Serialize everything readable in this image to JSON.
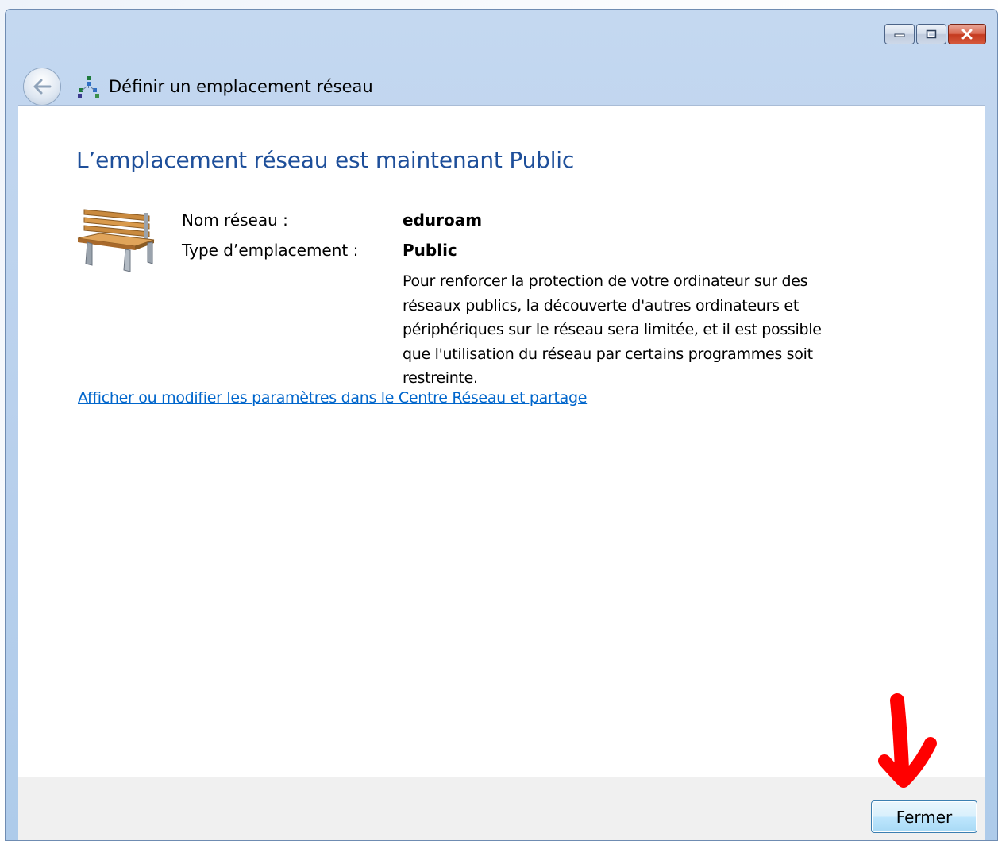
{
  "window": {
    "title": "Définir un emplacement réseau",
    "icons": {
      "back": "back-arrow-icon",
      "network": "network-icon",
      "minimize": "minimize-icon",
      "maximize": "maximize-icon",
      "close": "close-icon",
      "bench": "bench-icon"
    }
  },
  "main": {
    "headline": "L’emplacement réseau est maintenant Public",
    "fields": [
      {
        "label": "Nom réseau :",
        "value": "eduroam"
      },
      {
        "label": "Type d’emplacement :",
        "value": "Public"
      }
    ],
    "description_lines": [
      "Pour renforcer la protection de votre ordinateur sur des",
      "réseaux publics, la découverte d'autres ordinateurs et",
      "périphériques sur le réseau sera limitée, et il est possible",
      "que l'utilisation du réseau par certains programmes soit",
      "restreinte."
    ],
    "settings_link": "Afficher ou modifier les paramètres dans le Centre Réseau et partage"
  },
  "footer": {
    "close_label": "Fermer"
  },
  "colors": {
    "headline": "#1e4f9a",
    "link": "#0066cc",
    "annotation": "#ff0000"
  }
}
